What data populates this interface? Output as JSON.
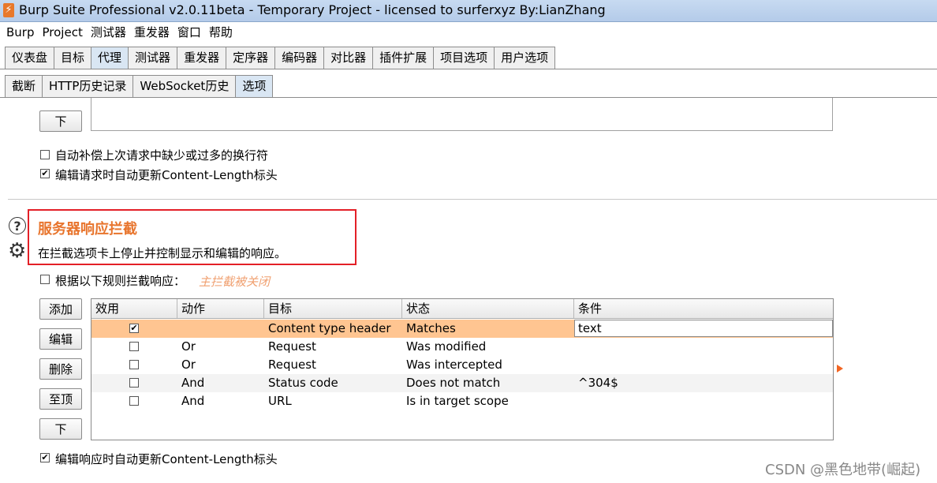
{
  "window": {
    "title": "Burp Suite Professional v2.0.11beta - Temporary Project - licensed to surferxyz By:LianZhang"
  },
  "menu": [
    "Burp",
    "Project",
    "测试器",
    "重发器",
    "窗口",
    "帮助"
  ],
  "main_tabs": [
    {
      "label": "仪表盘"
    },
    {
      "label": "目标"
    },
    {
      "label": "代理"
    },
    {
      "label": "测试器"
    },
    {
      "label": "重发器"
    },
    {
      "label": "定序器"
    },
    {
      "label": "编码器"
    },
    {
      "label": "对比器"
    },
    {
      "label": "插件扩展"
    },
    {
      "label": "项目选项"
    },
    {
      "label": "用户选项"
    }
  ],
  "main_tabs_active": "代理",
  "sub_tabs": [
    {
      "label": "截断"
    },
    {
      "label": "HTTP历史记录"
    },
    {
      "label": "WebSocket历史"
    },
    {
      "label": "选项"
    }
  ],
  "sub_tabs_active": "选项",
  "request_section": {
    "down_button": "下",
    "option_fix_newlines": {
      "label": "自动补偿上次请求中缺少或过多的换行符",
      "checked": false
    },
    "option_update_content_length": {
      "label": "编辑请求时自动更新Content-Length标头",
      "checked": true
    }
  },
  "response_section": {
    "title": "服务器响应拦截",
    "description": "在拦截选项卡上停止并控制显示和编辑的响应。",
    "intercept_rule_label": "根据以下规则拦截响应：",
    "intercept_rule_checked": false,
    "intercept_status": "主拦截被关闭",
    "buttons": {
      "add": "添加",
      "edit": "编辑",
      "remove": "删除",
      "top": "至顶",
      "down": "下"
    },
    "columns": [
      "效用",
      "动作",
      "目标",
      "状态",
      "条件"
    ],
    "rules": [
      {
        "enabled": true,
        "action": "",
        "target": "Content type header",
        "relationship": "Matches",
        "condition": "text"
      },
      {
        "enabled": false,
        "action": "Or",
        "target": "Request",
        "relationship": "Was modified",
        "condition": ""
      },
      {
        "enabled": false,
        "action": "Or",
        "target": "Request",
        "relationship": "Was intercepted",
        "condition": ""
      },
      {
        "enabled": false,
        "action": "And",
        "target": "Status code",
        "relationship": "Does not match",
        "condition": "^304$"
      },
      {
        "enabled": false,
        "action": "And",
        "target": "URL",
        "relationship": "Is in target scope",
        "condition": ""
      }
    ],
    "option_update_content_length": {
      "label": "编辑响应时自动更新Content-Length标头",
      "checked": true
    }
  },
  "watermark": "CSDN @黑色地带(崛起)",
  "colors": {
    "section_title": "#e8752d",
    "highlight_box": "#e32027",
    "selected_row": "#ffc591",
    "disabled_note": "#f0a070"
  }
}
